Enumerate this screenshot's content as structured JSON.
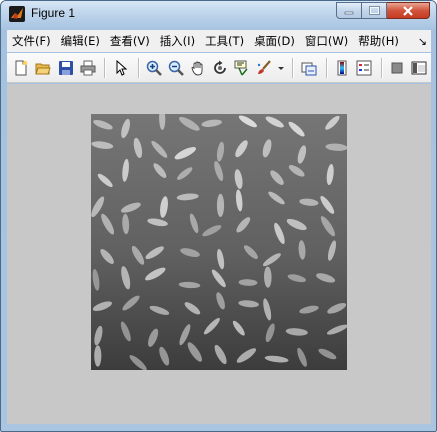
{
  "window": {
    "title": "Figure 1",
    "icon": "matlab-logo-icon"
  },
  "title_buttons": [
    "minimize-icon",
    "maximize-icon",
    "close-icon"
  ],
  "menu": {
    "items": [
      {
        "label": "文件(F)"
      },
      {
        "label": "编辑(E)"
      },
      {
        "label": "查看(V)"
      },
      {
        "label": "插入(I)"
      },
      {
        "label": "工具(T)"
      },
      {
        "label": "桌面(D)"
      },
      {
        "label": "窗口(W)"
      },
      {
        "label": "帮助(H)"
      }
    ],
    "overflow_label": "↘"
  },
  "toolbar": {
    "tools": [
      "new-figure-icon",
      "open-file-icon",
      "save-icon",
      "print-icon",
      "edit-plot-arrow-icon",
      "zoom-in-icon",
      "zoom-out-icon",
      "pan-hand-icon",
      "rotate-3d-icon",
      "data-cursor-icon",
      "brush-icon",
      "brush-dropdown-icon",
      "link-plot-icon",
      "insert-colorbar-icon",
      "insert-legend-icon",
      "hide-plot-tools-icon",
      "show-plot-tools-icon"
    ]
  },
  "figure": {
    "background_color": "#c8c8c8",
    "image": {
      "type": "grayscale photo",
      "subject": "rice grains on a dark textured background",
      "size": "256x256"
    }
  }
}
